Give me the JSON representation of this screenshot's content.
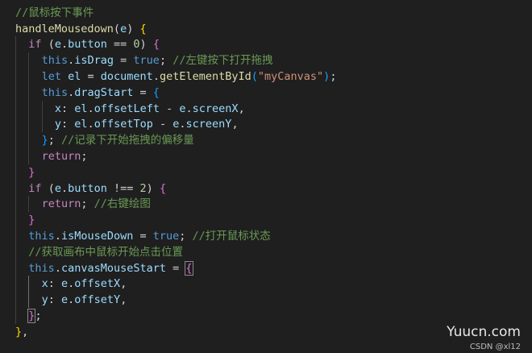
{
  "editor": {
    "lines": [
      {
        "indent": 0,
        "tokens": [
          {
            "t": "//鼠标按下事件",
            "c": "comment"
          }
        ]
      },
      {
        "indent": 0,
        "tokens": [
          {
            "t": "handleMousedown",
            "c": "function"
          },
          {
            "t": "(",
            "c": "punct"
          },
          {
            "t": "e",
            "c": "variable"
          },
          {
            "t": ") ",
            "c": "punct"
          },
          {
            "t": "{",
            "c": "brace"
          }
        ]
      },
      {
        "indent": 1,
        "tokens": [
          {
            "t": "if",
            "c": "control"
          },
          {
            "t": " (",
            "c": "punct"
          },
          {
            "t": "e",
            "c": "variable"
          },
          {
            "t": ".",
            "c": "punct"
          },
          {
            "t": "button",
            "c": "variable"
          },
          {
            "t": " == ",
            "c": "cmp"
          },
          {
            "t": "0",
            "c": "number"
          },
          {
            "t": ") ",
            "c": "punct"
          },
          {
            "t": "{",
            "c": "brace2"
          }
        ]
      },
      {
        "indent": 2,
        "tokens": [
          {
            "t": "this",
            "c": "keyword"
          },
          {
            "t": ".",
            "c": "punct"
          },
          {
            "t": "isDrag",
            "c": "variable"
          },
          {
            "t": " = ",
            "c": "cmp"
          },
          {
            "t": "true",
            "c": "boolean"
          },
          {
            "t": "; ",
            "c": "punct"
          },
          {
            "t": "//左键按下打开拖拽",
            "c": "comment"
          }
        ]
      },
      {
        "indent": 2,
        "tokens": [
          {
            "t": "let",
            "c": "keyword"
          },
          {
            "t": " ",
            "c": "punct"
          },
          {
            "t": "el",
            "c": "variable"
          },
          {
            "t": " = ",
            "c": "cmp"
          },
          {
            "t": "document",
            "c": "variable"
          },
          {
            "t": ".",
            "c": "punct"
          },
          {
            "t": "getElementById",
            "c": "function"
          },
          {
            "t": "(",
            "c": "brace3"
          },
          {
            "t": "\"myCanvas\"",
            "c": "string"
          },
          {
            "t": ")",
            "c": "brace3"
          },
          {
            "t": ";",
            "c": "punct"
          }
        ]
      },
      {
        "indent": 2,
        "tokens": [
          {
            "t": "this",
            "c": "keyword"
          },
          {
            "t": ".",
            "c": "punct"
          },
          {
            "t": "dragStart",
            "c": "variable"
          },
          {
            "t": " = ",
            "c": "cmp"
          },
          {
            "t": "{",
            "c": "brace3"
          }
        ]
      },
      {
        "indent": 3,
        "tokens": [
          {
            "t": "x",
            "c": "variable"
          },
          {
            "t": ": ",
            "c": "punct"
          },
          {
            "t": "el",
            "c": "variable"
          },
          {
            "t": ".",
            "c": "punct"
          },
          {
            "t": "offsetLeft",
            "c": "variable"
          },
          {
            "t": " - ",
            "c": "cmp"
          },
          {
            "t": "e",
            "c": "variable"
          },
          {
            "t": ".",
            "c": "punct"
          },
          {
            "t": "screenX",
            "c": "variable"
          },
          {
            "t": ",",
            "c": "punct"
          }
        ]
      },
      {
        "indent": 3,
        "tokens": [
          {
            "t": "y",
            "c": "variable"
          },
          {
            "t": ": ",
            "c": "punct"
          },
          {
            "t": "el",
            "c": "variable"
          },
          {
            "t": ".",
            "c": "punct"
          },
          {
            "t": "offsetTop",
            "c": "variable"
          },
          {
            "t": " - ",
            "c": "cmp"
          },
          {
            "t": "e",
            "c": "variable"
          },
          {
            "t": ".",
            "c": "punct"
          },
          {
            "t": "screenY",
            "c": "variable"
          },
          {
            "t": ",",
            "c": "punct"
          }
        ]
      },
      {
        "indent": 2,
        "tokens": [
          {
            "t": "}",
            "c": "brace3"
          },
          {
            "t": "; ",
            "c": "punct"
          },
          {
            "t": "//记录下开始拖拽的偏移量",
            "c": "comment"
          }
        ]
      },
      {
        "indent": 2,
        "tokens": [
          {
            "t": "return",
            "c": "control"
          },
          {
            "t": ";",
            "c": "punct"
          }
        ]
      },
      {
        "indent": 1,
        "tokens": [
          {
            "t": "}",
            "c": "brace2"
          }
        ]
      },
      {
        "indent": 1,
        "tokens": [
          {
            "t": "if",
            "c": "control"
          },
          {
            "t": " (",
            "c": "punct"
          },
          {
            "t": "e",
            "c": "variable"
          },
          {
            "t": ".",
            "c": "punct"
          },
          {
            "t": "button",
            "c": "variable"
          },
          {
            "t": " !== ",
            "c": "cmp"
          },
          {
            "t": "2",
            "c": "number"
          },
          {
            "t": ") ",
            "c": "punct"
          },
          {
            "t": "{",
            "c": "brace2"
          }
        ]
      },
      {
        "indent": 2,
        "tokens": [
          {
            "t": "return",
            "c": "control"
          },
          {
            "t": "; ",
            "c": "punct"
          },
          {
            "t": "//右键绘图",
            "c": "comment"
          }
        ]
      },
      {
        "indent": 1,
        "tokens": [
          {
            "t": "}",
            "c": "brace2"
          }
        ]
      },
      {
        "indent": 1,
        "tokens": [
          {
            "t": "this",
            "c": "keyword"
          },
          {
            "t": ".",
            "c": "punct"
          },
          {
            "t": "isMouseDown",
            "c": "variable"
          },
          {
            "t": " = ",
            "c": "cmp"
          },
          {
            "t": "true",
            "c": "boolean"
          },
          {
            "t": "; ",
            "c": "punct"
          },
          {
            "t": "//打开鼠标状态",
            "c": "comment"
          }
        ]
      },
      {
        "indent": 1,
        "tokens": [
          {
            "t": "//获取画布中鼠标开始点击位置",
            "c": "comment"
          }
        ]
      },
      {
        "indent": 1,
        "tokens": [
          {
            "t": "this",
            "c": "keyword"
          },
          {
            "t": ".",
            "c": "punct"
          },
          {
            "t": "canvasMouseStart",
            "c": "variable"
          },
          {
            "t": " = ",
            "c": "cmp"
          },
          {
            "t": "{",
            "c": "brace2",
            "match": true
          }
        ]
      },
      {
        "indent": 2,
        "tokens": [
          {
            "t": "x",
            "c": "variable"
          },
          {
            "t": ": ",
            "c": "punct"
          },
          {
            "t": "e",
            "c": "variable"
          },
          {
            "t": ".",
            "c": "punct"
          },
          {
            "t": "offsetX",
            "c": "variable"
          },
          {
            "t": ",",
            "c": "punct"
          }
        ]
      },
      {
        "indent": 2,
        "tokens": [
          {
            "t": "y",
            "c": "variable"
          },
          {
            "t": ": ",
            "c": "punct"
          },
          {
            "t": "e",
            "c": "variable"
          },
          {
            "t": ".",
            "c": "punct"
          },
          {
            "t": "offsetY",
            "c": "variable"
          },
          {
            "t": ",",
            "c": "punct"
          }
        ]
      },
      {
        "indent": 1,
        "tokens": [
          {
            "t": "}",
            "c": "brace2",
            "match": true
          },
          {
            "t": ";",
            "c": "punct"
          }
        ]
      },
      {
        "indent": 0,
        "tokens": [
          {
            "t": "}",
            "c": "brace"
          },
          {
            "t": ",",
            "c": "punct"
          }
        ]
      }
    ]
  },
  "watermark": {
    "site": "Yuucn.com",
    "credit": "CSDN @xl12"
  }
}
